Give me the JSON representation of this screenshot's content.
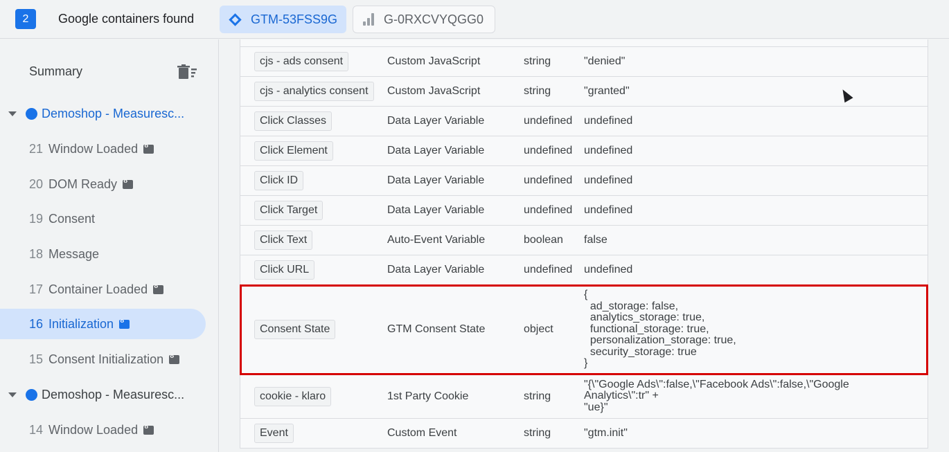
{
  "topbar": {
    "container_count": "2",
    "found_text": "Google containers found",
    "tabs": [
      {
        "label": "GTM-53FSS9G",
        "icon": "gtm-diamond-icon",
        "active": true
      },
      {
        "label": "G-0RXCVYQGG0",
        "icon": "analytics-bars-icon",
        "active": false
      }
    ]
  },
  "sidebar": {
    "summary_label": "Summary",
    "groups": [
      {
        "label": "Demoshop - Measuresc...",
        "items": [
          {
            "num": "21",
            "label": "Window Loaded"
          },
          {
            "num": "20",
            "label": "DOM Ready"
          },
          {
            "num": "19",
            "label": "Consent"
          },
          {
            "num": "18",
            "label": "Message"
          },
          {
            "num": "17",
            "label": "Container Loaded"
          },
          {
            "num": "16",
            "label": "Initialization",
            "active": true
          },
          {
            "num": "15",
            "label": "Consent Initialization"
          }
        ]
      },
      {
        "label": "Demoshop - Measuresc...",
        "items": [
          {
            "num": "14",
            "label": "Window Loaded"
          }
        ]
      }
    ]
  },
  "variables": [
    {
      "name": "cjs - ads consent",
      "type": "Custom JavaScript",
      "dtype": "string",
      "value": "\"denied\""
    },
    {
      "name": "cjs - analytics consent",
      "type": "Custom JavaScript",
      "dtype": "string",
      "value": "\"granted\""
    },
    {
      "name": "Click Classes",
      "type": "Data Layer Variable",
      "dtype": "undefined",
      "value": "undefined"
    },
    {
      "name": "Click Element",
      "type": "Data Layer Variable",
      "dtype": "undefined",
      "value": "undefined"
    },
    {
      "name": "Click ID",
      "type": "Data Layer Variable",
      "dtype": "undefined",
      "value": "undefined"
    },
    {
      "name": "Click Target",
      "type": "Data Layer Variable",
      "dtype": "undefined",
      "value": "undefined"
    },
    {
      "name": "Click Text",
      "type": "Auto-Event Variable",
      "dtype": "boolean",
      "value": "false"
    },
    {
      "name": "Click URL",
      "type": "Data Layer Variable",
      "dtype": "undefined",
      "value": "undefined"
    },
    {
      "name": "Consent State",
      "type": "GTM Consent State",
      "dtype": "object",
      "value": "{\n  ad_storage: false,\n  analytics_storage: true,\n  functional_storage: true,\n  personalization_storage: true,\n  security_storage: true\n}",
      "highlight": true
    },
    {
      "name": "cookie - klaro",
      "type": "1st Party Cookie",
      "dtype": "string",
      "value": "\"{\\\"Google Ads\\\":false,\\\"Facebook Ads\\\":false,\\\"Google\nAnalytics\\\":tr\" +\n\"ue}\""
    },
    {
      "name": "Event",
      "type": "Custom Event",
      "dtype": "string",
      "value": "\"gtm.init\""
    }
  ]
}
